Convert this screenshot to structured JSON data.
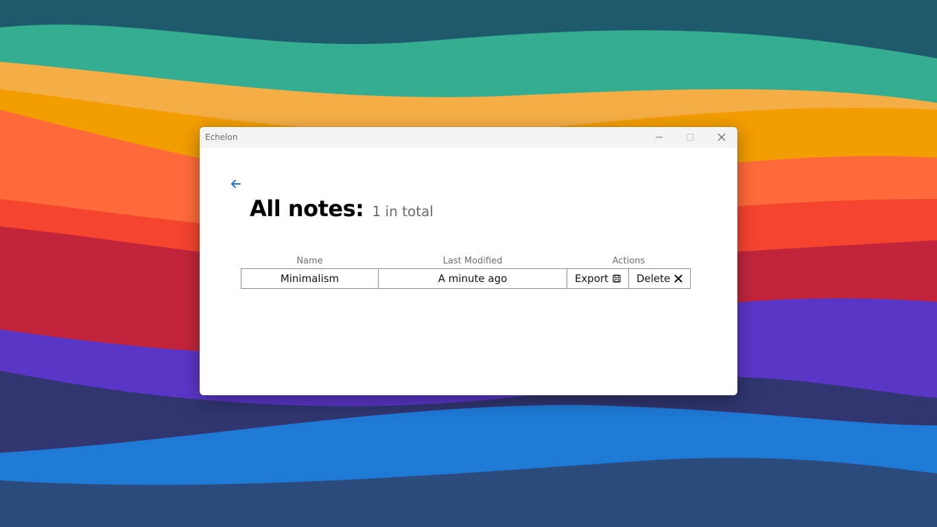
{
  "window": {
    "title": "Echelon",
    "controls": {
      "minimize": "minimize-icon",
      "maximize": "maximize-icon",
      "close": "close-icon"
    }
  },
  "page": {
    "back_icon": "arrow-left-icon",
    "title": "All notes:",
    "count_text": "1 in total"
  },
  "table": {
    "headers": {
      "name": "Name",
      "modified": "Last Modified",
      "actions": "Actions"
    },
    "rows": [
      {
        "name": "Minimalism",
        "modified": "A minute ago",
        "export_label": "Export",
        "export_icon": "save-icon",
        "delete_label": "Delete",
        "delete_icon": "close-x-icon"
      }
    ]
  },
  "colors": {
    "accent": "#1a73e8",
    "titlebar": "#f3f3f3",
    "muted_text": "#6b6b6b",
    "cell_border": "#8a8a8a"
  }
}
